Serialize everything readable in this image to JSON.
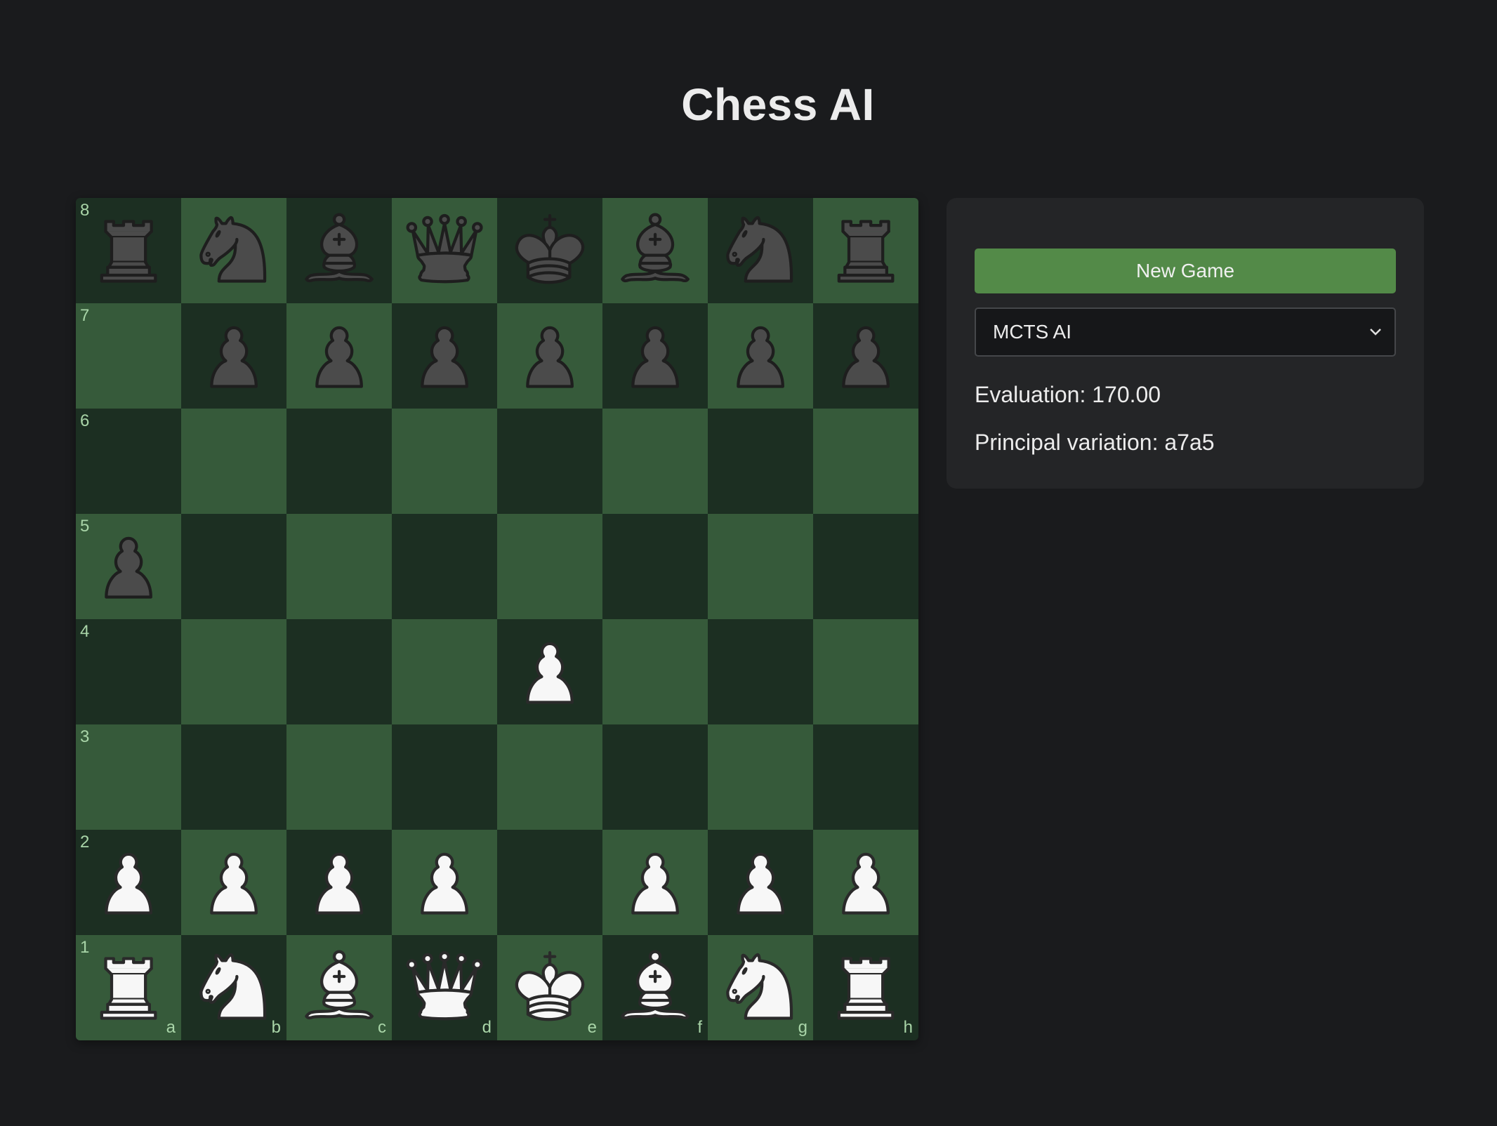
{
  "title": "Chess AI",
  "controls": {
    "new_game_label": "New Game",
    "ai_select_value": "MCTS AI"
  },
  "info": {
    "evaluation_text": "Evaluation: 170.00",
    "pv_text": "Principal variation: a7a5"
  },
  "board": {
    "files": [
      "a",
      "b",
      "c",
      "d",
      "e",
      "f",
      "g",
      "h"
    ],
    "ranks": [
      "8",
      "7",
      "6",
      "5",
      "4",
      "3",
      "2",
      "1"
    ],
    "position": [
      [
        "br",
        "bn",
        "bb",
        "bq",
        "bk",
        "bb",
        "bn",
        "br"
      ],
      [
        "",
        "bp",
        "bp",
        "bp",
        "bp",
        "bp",
        "bp",
        "bp"
      ],
      [
        "",
        "",
        "",
        "",
        "",
        "",
        "",
        ""
      ],
      [
        "bp",
        "",
        "",
        "",
        "",
        "",
        "",
        ""
      ],
      [
        "",
        "",
        "",
        "",
        "wp",
        "",
        "",
        ""
      ],
      [
        "",
        "",
        "",
        "",
        "",
        "",
        "",
        ""
      ],
      [
        "wp",
        "wp",
        "wp",
        "wp",
        "",
        "wp",
        "wp",
        "wp"
      ],
      [
        "wr",
        "wn",
        "wb",
        "wq",
        "wk",
        "wb",
        "wn",
        "wr"
      ]
    ],
    "piece_names": {
      "p": "pawn",
      "n": "knight",
      "b": "bishop",
      "r": "rook",
      "q": "queen",
      "k": "king"
    },
    "colors": {
      "dark_square": "#1c2f22",
      "light_square": "#365a3a",
      "white_piece": "#f7f7f7",
      "black_piece": "#4b4b4b"
    }
  }
}
